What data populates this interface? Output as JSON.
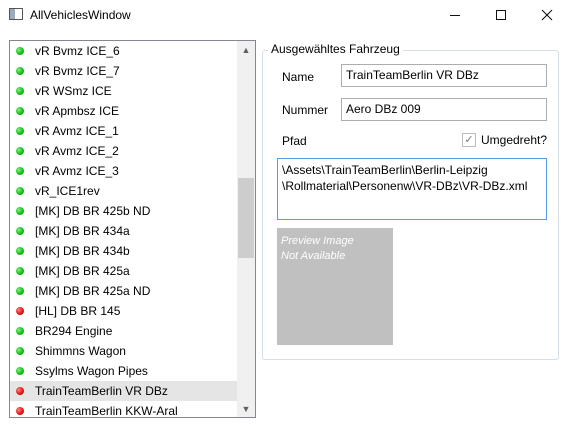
{
  "window": {
    "title": "AllVehiclesWindow"
  },
  "vehicle_list": {
    "items": [
      {
        "label": "vR Bvmz ICE_6",
        "status": "green"
      },
      {
        "label": "vR Bvmz ICE_7",
        "status": "green"
      },
      {
        "label": "vR WSmz ICE",
        "status": "green"
      },
      {
        "label": "vR Apmbsz ICE",
        "status": "green"
      },
      {
        "label": "vR Avmz ICE_1",
        "status": "green"
      },
      {
        "label": "vR Avmz ICE_2",
        "status": "green"
      },
      {
        "label": "vR Avmz ICE_3",
        "status": "green"
      },
      {
        "label": "vR_ICE1rev",
        "status": "green"
      },
      {
        "label": "[MK] DB BR 425b ND",
        "status": "green"
      },
      {
        "label": "[MK] DB BR 434a",
        "status": "green"
      },
      {
        "label": "[MK] DB BR 434b",
        "status": "green"
      },
      {
        "label": "[MK] DB BR 425a",
        "status": "green"
      },
      {
        "label": "[MK] DB BR 425a ND",
        "status": "green"
      },
      {
        "label": "[HL] DB BR 145",
        "status": "red"
      },
      {
        "label": "BR294 Engine",
        "status": "green"
      },
      {
        "label": "Shimmns Wagon",
        "status": "green"
      },
      {
        "label": "Ssylms Wagon Pipes",
        "status": "green"
      },
      {
        "label": "TrainTeamBerlin VR DBz",
        "status": "red",
        "selected": true
      },
      {
        "label": "TrainTeamBerlin KKW-Aral",
        "status": "red"
      }
    ],
    "scroll_up_glyph": "▲",
    "scroll_down_glyph": "▼"
  },
  "details": {
    "group_title": "Ausgewähltes Fahrzeug",
    "name_label": "Name",
    "name_value": "TrainTeamBerlin VR DBz",
    "number_label": "Nummer",
    "number_value": "Aero DBz 009",
    "path_label": "Pfad",
    "reversed_label": "Umgedreht?",
    "reversed_checked": true,
    "check_glyph": "✓",
    "path_lines": [
      "\\Assets\\TrainTeamBerlin\\Berlin-Leipzig",
      "\\Rollmaterial\\Personenw\\VR-DBz\\VR-DBz.xml"
    ],
    "preview_lines": [
      "Preview Image",
      "Not Available"
    ]
  },
  "colors": {
    "status_green": "#0fb80f",
    "status_red": "#e01010",
    "selection": "#e5e5e5",
    "focus_border": "#569de5"
  },
  "icons": {
    "minimize": "minimize-icon",
    "maximize": "maximize-icon",
    "close": "close-icon"
  }
}
